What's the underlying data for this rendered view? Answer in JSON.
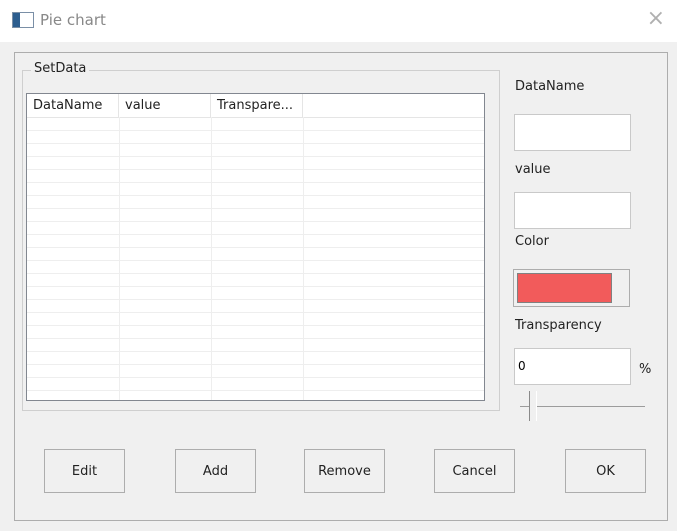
{
  "window": {
    "title": "Pie chart",
    "close_glyph": "×"
  },
  "group": {
    "label": "SetData"
  },
  "table": {
    "columns": [
      "DataName",
      "value",
      "Transpare..."
    ],
    "rows": []
  },
  "form": {
    "dataname_label": "DataName",
    "dataname_value": "",
    "value_label": "value",
    "value_value": "",
    "color_label": "Color",
    "color_value": "#f25b5b",
    "transparency_label": "Transparency",
    "transparency_value": "0",
    "percent_sign": "%",
    "slider_value": 0
  },
  "buttons": {
    "edit": "Edit",
    "add": "Add",
    "remove": "Remove",
    "cancel": "Cancel",
    "ok": "OK"
  }
}
